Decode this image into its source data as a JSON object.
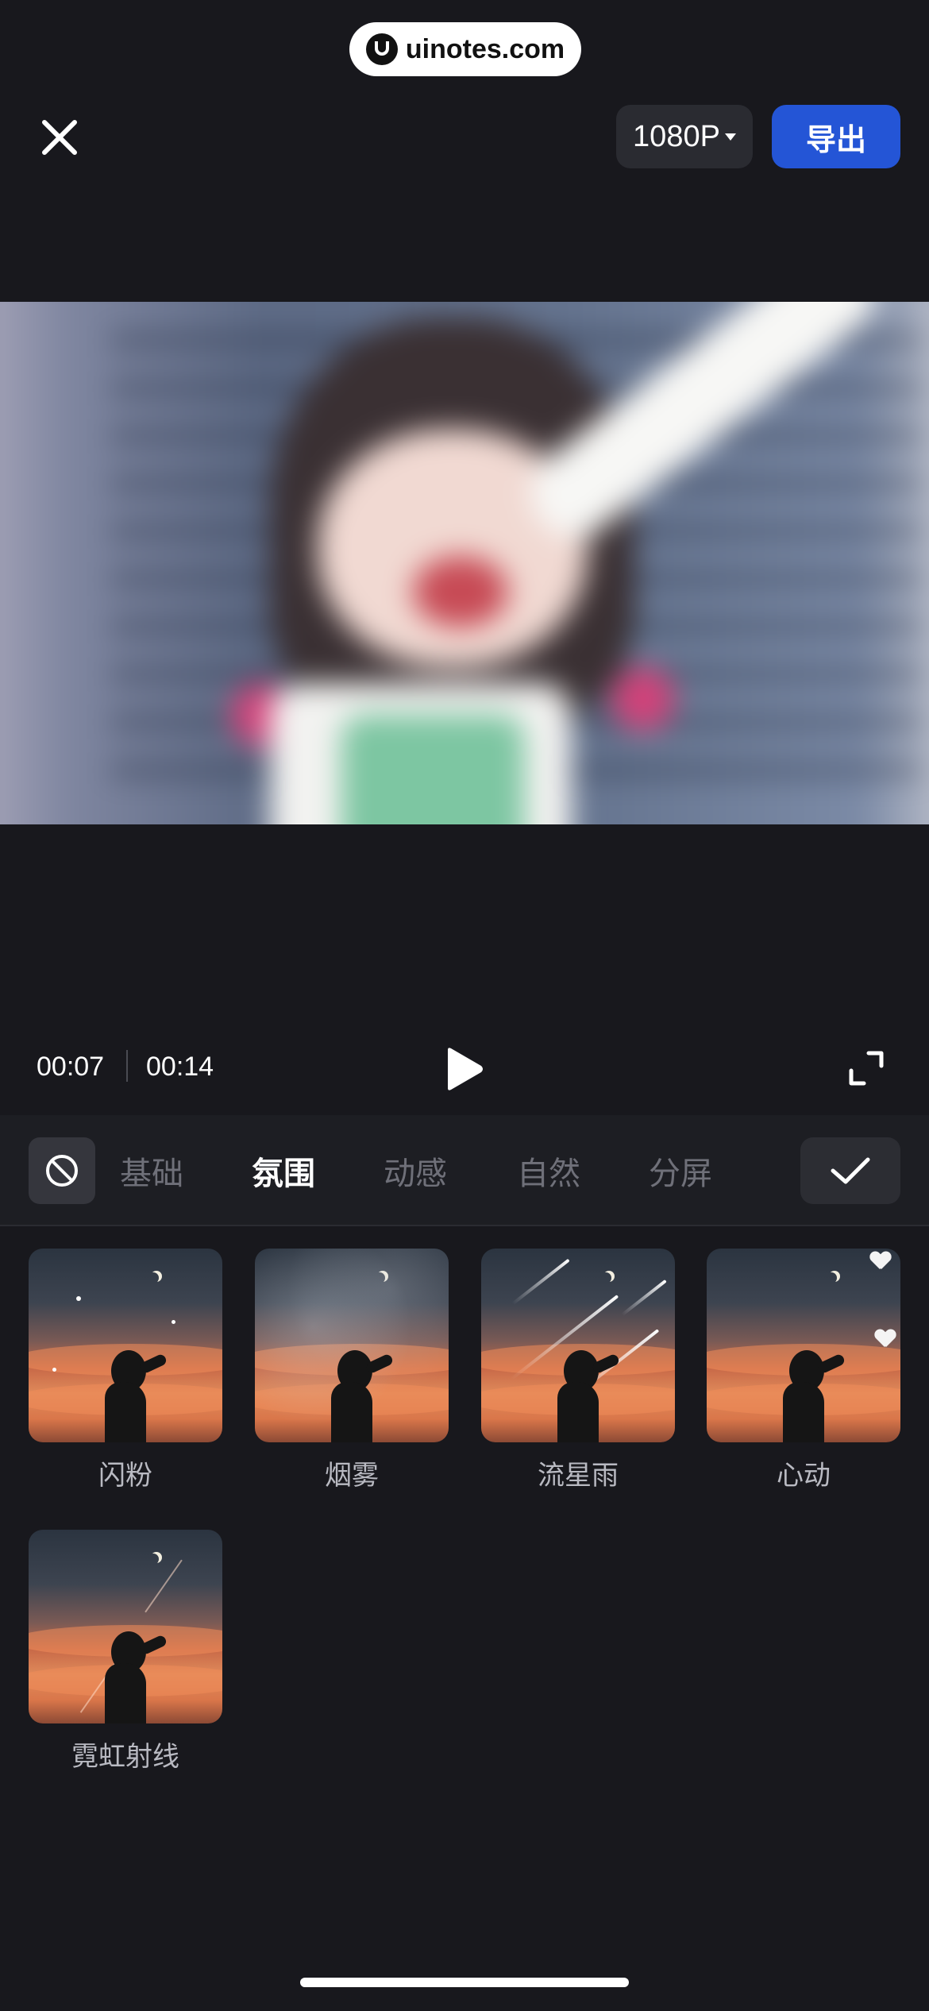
{
  "watermark": {
    "text": "uinotes.com"
  },
  "topbar": {
    "close_icon": "close-icon",
    "resolution": "1080P",
    "export_label": "导出",
    "export_color": "#2455d6"
  },
  "playback": {
    "current_time": "00:07",
    "total_time": "00:14",
    "play_icon": "play-icon",
    "fullscreen_icon": "fullscreen-icon"
  },
  "tabs": {
    "none_icon": "no-effect-icon",
    "items": [
      {
        "label": "基础",
        "active": false
      },
      {
        "label": "氛围",
        "active": true
      },
      {
        "label": "动感",
        "active": false
      },
      {
        "label": "自然",
        "active": false
      },
      {
        "label": "分屏",
        "active": false
      }
    ],
    "confirm_icon": "checkmark-icon"
  },
  "effects": [
    {
      "label": "闪粉"
    },
    {
      "label": "烟雾"
    },
    {
      "label": "流星雨"
    },
    {
      "label": "心动"
    },
    {
      "label": "霓虹射线"
    }
  ]
}
